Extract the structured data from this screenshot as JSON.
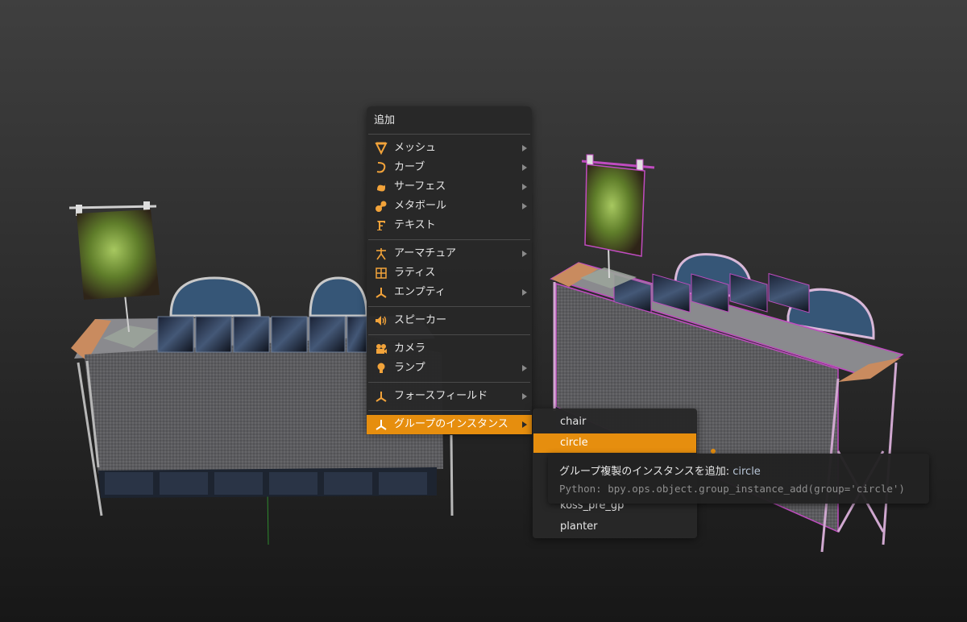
{
  "add_menu": {
    "title": "追加",
    "items": [
      {
        "label": "メッシュ",
        "icon": "mesh-icon",
        "submenu": true
      },
      {
        "label": "カーブ",
        "icon": "curve-icon",
        "submenu": true
      },
      {
        "label": "サーフェス",
        "icon": "surface-icon",
        "submenu": true
      },
      {
        "label": "メタボール",
        "icon": "metaball-icon",
        "submenu": true
      },
      {
        "label": "テキスト",
        "icon": "text-icon",
        "submenu": false
      },
      {
        "label": "アーマチュア",
        "icon": "armature-icon",
        "submenu": true
      },
      {
        "label": "ラティス",
        "icon": "lattice-icon",
        "submenu": false
      },
      {
        "label": "エンプティ",
        "icon": "empty-icon",
        "submenu": true
      },
      {
        "label": "スピーカー",
        "icon": "speaker-icon",
        "submenu": false
      },
      {
        "label": "カメラ",
        "icon": "camera-icon",
        "submenu": false
      },
      {
        "label": "ランプ",
        "icon": "lamp-icon",
        "submenu": true
      },
      {
        "label": "フォースフィールド",
        "icon": "force-field-icon",
        "submenu": true
      },
      {
        "label": "グループのインスタンス",
        "icon": "group-instance-icon",
        "submenu": true,
        "active": true
      }
    ]
  },
  "group_submenu": {
    "items": [
      {
        "label": "chair",
        "active": false
      },
      {
        "label": "circle",
        "active": true
      },
      {
        "label": "",
        "active": false
      },
      {
        "label": "",
        "active": false
      },
      {
        "label": "koss_pre_gp",
        "active": false
      },
      {
        "label": "planter",
        "active": false
      }
    ]
  },
  "tooltip": {
    "description": "グループ複製のインスタンスを追加:",
    "value": "circle",
    "python": "Python: bpy.ops.object.group_instance_add(group='circle')"
  },
  "theme": {
    "accent": "#e68e0e",
    "icon_color": "#f2a33a",
    "selection_outline": "#c04cc0"
  }
}
